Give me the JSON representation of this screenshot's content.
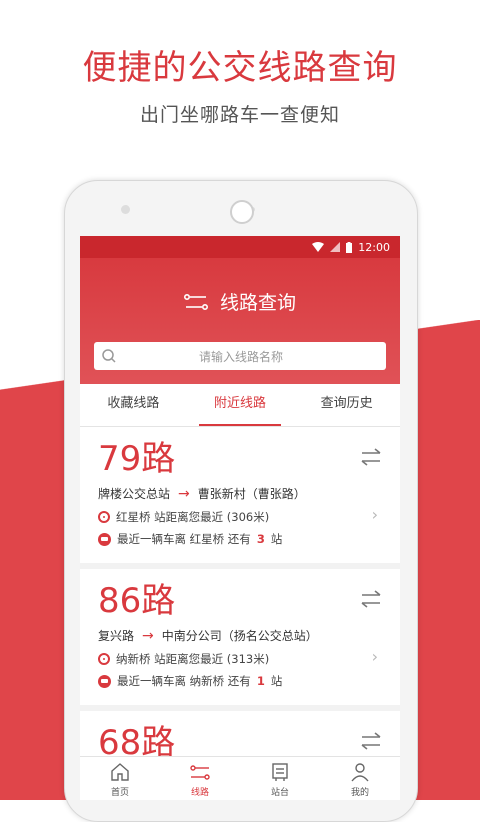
{
  "promo": {
    "headline": "便捷的公交线路查询",
    "subline": "出门坐哪路车一查便知"
  },
  "status": {
    "time": "12:00"
  },
  "header": {
    "title": "线路查询"
  },
  "search": {
    "placeholder": "请输入线路名称"
  },
  "tabs": [
    {
      "label": "收藏线路"
    },
    {
      "label": "附近线路",
      "active": true
    },
    {
      "label": "查询历史"
    }
  ],
  "routes": [
    {
      "name": "79路",
      "from": "牌楼公交总站",
      "to": "曹张新村（曹张路）",
      "station": "红星桥 站距离您最近 (306米)",
      "arrival_prefix": "最近一辆车离 红星桥 还有",
      "stops": "3",
      "arrival_suffix": "站"
    },
    {
      "name": "86路",
      "from": "复兴路",
      "to": "中南分公司（扬名公交总站）",
      "station": "纳新桥 站距离您最近 (313米)",
      "arrival_prefix": "最近一辆车离 纳新桥 还有",
      "stops": "1",
      "arrival_suffix": "站"
    },
    {
      "name": "68路"
    }
  ],
  "nav": [
    {
      "label": "首页",
      "icon": "home-icon"
    },
    {
      "label": "线路",
      "icon": "route-icon",
      "active": true
    },
    {
      "label": "站台",
      "icon": "station-icon"
    },
    {
      "label": "我的",
      "icon": "user-icon"
    }
  ],
  "colors": {
    "accent": "#d9393e",
    "band": "#e0454a"
  }
}
